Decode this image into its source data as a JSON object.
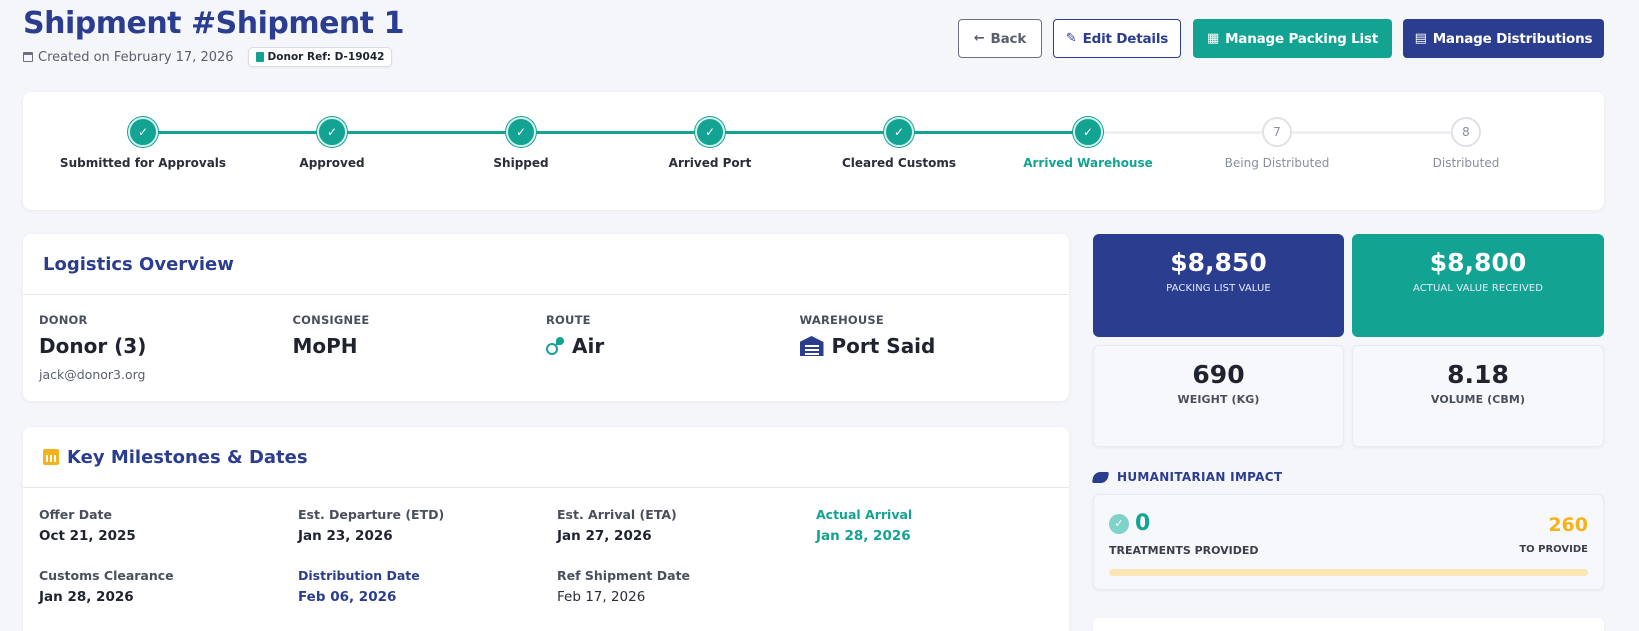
{
  "header": {
    "title": "Shipment #Shipment 1",
    "created": "Created on February 17, 2026",
    "donor_ref": "Donor Ref: D-19042"
  },
  "actions": {
    "back": "Back",
    "edit": "Edit Details",
    "packing": "Manage Packing List",
    "distributions": "Manage Distributions"
  },
  "stepper": {
    "steps": [
      {
        "label": "Submitted for Approvals",
        "status": "done"
      },
      {
        "label": "Approved",
        "status": "done"
      },
      {
        "label": "Shipped",
        "status": "done"
      },
      {
        "label": "Arrived Port",
        "status": "done"
      },
      {
        "label": "Cleared Customs",
        "status": "done"
      },
      {
        "label": "Arrived Warehouse",
        "status": "current"
      },
      {
        "label": "Being Distributed",
        "status": "todo",
        "number": "7"
      },
      {
        "label": "Distributed",
        "status": "todo",
        "number": "8"
      }
    ]
  },
  "logistics": {
    "title": "Logistics Overview",
    "donor": {
      "label": "DONOR",
      "value": "Donor (3)",
      "email": "jack@donor3.org"
    },
    "consignee": {
      "label": "CONSIGNEE",
      "value": "MoPH"
    },
    "route": {
      "label": "ROUTE",
      "value": "Air",
      "icon": "route-icon"
    },
    "warehouse": {
      "label": "WAREHOUSE",
      "value": "Port Said",
      "icon": "warehouse-icon"
    }
  },
  "milestones": {
    "title": "Key Milestones & Dates",
    "items": [
      {
        "label": "Offer Date",
        "value": "Oct 21, 2025"
      },
      {
        "label": "Est. Departure (ETD)",
        "value": "Jan 23, 2026"
      },
      {
        "label": "Est. Arrival (ETA)",
        "value": "Jan 27, 2026"
      },
      {
        "label": "Actual Arrival",
        "value": "Jan 28, 2026"
      },
      {
        "label": "Customs Clearance",
        "value": "Jan 28, 2026"
      },
      {
        "label": "Distribution Date",
        "value": "Feb 06, 2026"
      },
      {
        "label": "Ref Shipment Date",
        "value": "Feb 17, 2026"
      }
    ]
  },
  "stats": {
    "packing_value": "$8,850",
    "packing_label": "PACKING LIST VALUE",
    "received_value": "$8,800",
    "received_label": "ACTUAL VALUE RECEIVED",
    "weight_value": "690",
    "weight_label": "WEIGHT (KG)",
    "volume_value": "8.18",
    "volume_label": "VOLUME (CBM)"
  },
  "impact": {
    "title": "HUMANITARIAN IMPACT",
    "provided": "0",
    "provided_label": "TREATMENTS PROVIDED",
    "to_provide": "260",
    "to_provide_label": "TO PROVIDE",
    "progress": 0
  },
  "colors": {
    "navy": "#2b3d8f",
    "teal": "#13a392",
    "amber": "#f6b21a"
  }
}
